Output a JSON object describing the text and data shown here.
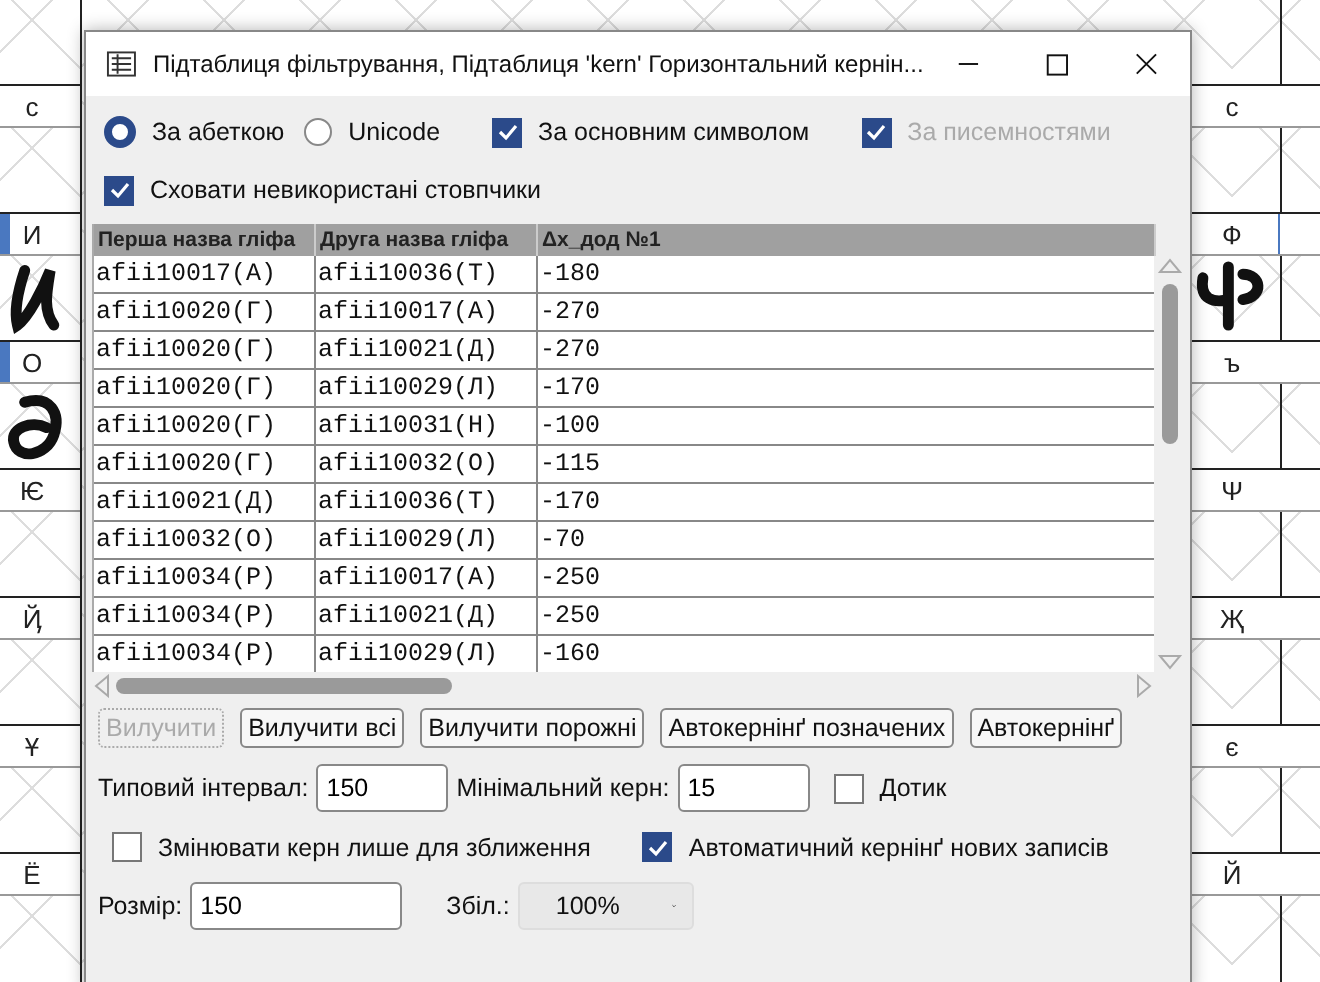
{
  "background": {
    "left_column": [
      {
        "label": "с",
        "marked": false,
        "kind": "empty"
      },
      {
        "label": "И",
        "marked": true,
        "kind": "cursive"
      },
      {
        "label": "О",
        "marked": true,
        "kind": "swirl"
      },
      {
        "label": "Ѥ",
        "marked": false,
        "kind": "empty"
      },
      {
        "label": "Ҋ",
        "marked": false,
        "kind": "empty"
      },
      {
        "label": "Ұ",
        "marked": false,
        "kind": "empty"
      },
      {
        "label": "Ё",
        "marked": false,
        "kind": "empty"
      }
    ],
    "right_column": [
      {
        "label": "с",
        "marked": false,
        "kind": "empty"
      },
      {
        "label": "Ф",
        "marked": true,
        "kind": "trident"
      },
      {
        "label": "ъ",
        "marked": false,
        "kind": "empty"
      },
      {
        "label": "Ψ",
        "marked": false,
        "kind": "empty"
      },
      {
        "label": "Җ",
        "marked": false,
        "kind": "empty"
      },
      {
        "label": "є",
        "marked": false,
        "kind": "empty"
      },
      {
        "label": "Й",
        "marked": false,
        "kind": "empty"
      }
    ]
  },
  "window": {
    "title": "Підтаблиця фільтрування, Підтаблиця 'kern' Горизонтальний кернін..."
  },
  "options": [
    {
      "kind": "radio",
      "label": "За абеткою",
      "selected": true,
      "disabled": false
    },
    {
      "kind": "radio",
      "label": "Unicode",
      "selected": false,
      "disabled": false
    },
    {
      "kind": "checkbox",
      "label": "За основним символом",
      "checked": true,
      "disabled": false
    },
    {
      "kind": "checkbox",
      "label": "За писемностями",
      "checked": true,
      "disabled": true
    }
  ],
  "hide_unused": {
    "label": "Сховати невикористані стовпчики",
    "checked": true
  },
  "table": {
    "columns": [
      "Перша назва гліфа",
      "Друга назва гліфа",
      "Δx_дод №1"
    ],
    "rows": [
      [
        "afii10017(А)",
        "afii10036(Т)",
        "-180"
      ],
      [
        "afii10020(Г)",
        "afii10017(А)",
        "-270"
      ],
      [
        "afii10020(Г)",
        "afii10021(Д)",
        "-270"
      ],
      [
        "afii10020(Г)",
        "afii10029(Л)",
        "-170"
      ],
      [
        "afii10020(Г)",
        "afii10031(Н)",
        "-100"
      ],
      [
        "afii10020(Г)",
        "afii10032(О)",
        "-115"
      ],
      [
        "afii10021(Д)",
        "afii10036(Т)",
        "-170"
      ],
      [
        "afii10032(О)",
        "afii10029(Л)",
        "-70"
      ],
      [
        "afii10034(Р)",
        "afii10017(А)",
        "-250"
      ],
      [
        "afii10034(Р)",
        "afii10021(Д)",
        "-250"
      ],
      [
        "afii10034(Р)",
        "afii10029(Л)",
        "-160"
      ]
    ]
  },
  "buttons": [
    {
      "label": "Вилучити",
      "disabled": true
    },
    {
      "label": "Вилучити всі",
      "disabled": false
    },
    {
      "label": "Вилучити порожні",
      "disabled": false
    },
    {
      "label": "Автокернінґ позначених",
      "disabled": false
    },
    {
      "label": "Автокернінґ",
      "disabled": false
    }
  ],
  "spacing": {
    "label": "Типовий інтервал:",
    "value": "150"
  },
  "min_kern": {
    "label": "Мінімальний керн:",
    "value": "15"
  },
  "touch": {
    "label": "Дотик",
    "checked": false
  },
  "only_closer": {
    "label": "Змінювати керн лише для зближення",
    "checked": false
  },
  "auto_new": {
    "label": "Автоматичний кернінґ нових записів",
    "checked": true
  },
  "size": {
    "label": "Розмір:",
    "value": "150"
  },
  "zoom": {
    "label": "Збіл.:",
    "value": "100%"
  }
}
